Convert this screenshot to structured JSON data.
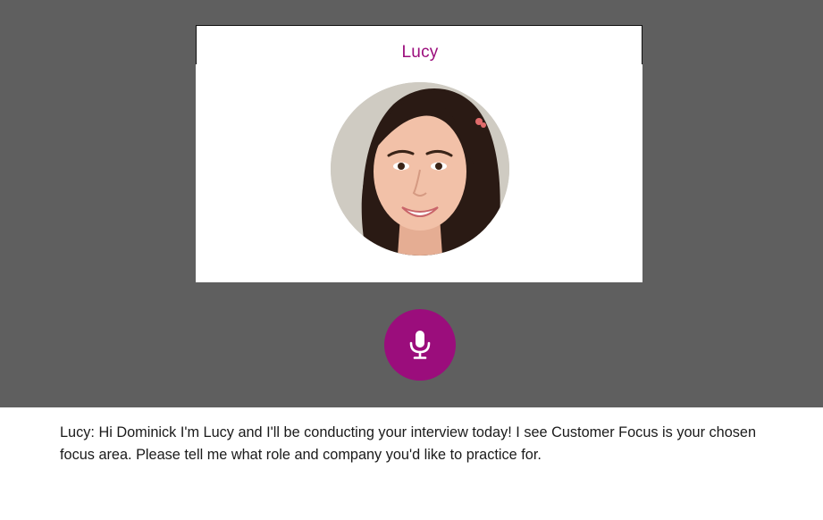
{
  "interviewer": {
    "name": "Lucy",
    "avatar_alt": "Lucy"
  },
  "controls": {
    "mic_icon": "microphone-icon"
  },
  "transcript": {
    "speaker": "Lucy:",
    "message": " Hi Dominick I'm Lucy and I'll be conducting your interview today! I see Customer Focus is your chosen focus area. Please tell me what role and company you'd like to practice for."
  },
  "colors": {
    "accent": "#9b0d7c",
    "stage_background": "#5f5f5f",
    "card_background": "#ffffff"
  }
}
